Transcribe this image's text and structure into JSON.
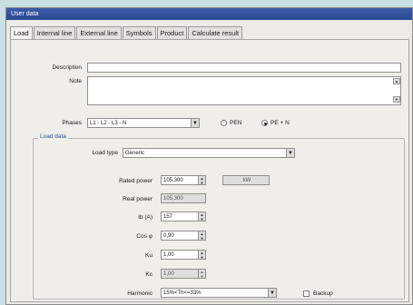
{
  "window": {
    "title": "User data"
  },
  "tabs": [
    "Load",
    "Internal line",
    "External line",
    "Symbols",
    "Product",
    "Calculate result"
  ],
  "description": {
    "label": "Description",
    "value": ""
  },
  "note": {
    "label": "Note",
    "value": ""
  },
  "phases": {
    "label": "Phases",
    "value": "L1 - L2 - L3 - N",
    "option_pen": "PEN",
    "option_pe_n": "PE + N",
    "selected": "PE + N"
  },
  "load_data": {
    "title": "Load data",
    "load_type": {
      "label": "Load type",
      "value": "Generic"
    },
    "rated_power": {
      "label": "Rated power",
      "value": "105,300",
      "unit": "kW"
    },
    "real_power": {
      "label": "Real power",
      "value": "105,300"
    },
    "ib": {
      "label": "Ib (A)",
      "value": "157"
    },
    "cos_phi": {
      "label": "Cos φ",
      "value": "0,90"
    },
    "ku": {
      "label": "Ku",
      "value": "1,00"
    },
    "kc": {
      "label": "Kc",
      "value": "1,00"
    },
    "harmonic": {
      "label": "Harmonic",
      "value": "15%<Th<=33%"
    },
    "backup": {
      "label": "Backup",
      "checked": false
    }
  }
}
